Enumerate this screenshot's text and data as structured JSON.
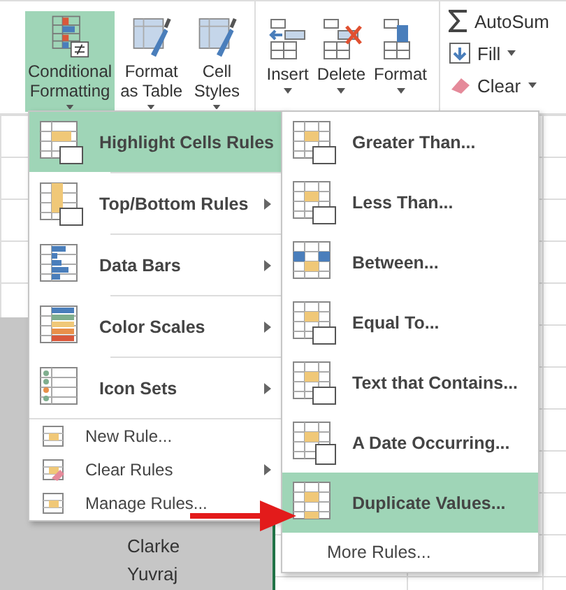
{
  "ribbon": {
    "styles_group": [
      {
        "label": "Conditional Formatting",
        "selected": true
      },
      {
        "label": "Format as Table",
        "selected": false
      },
      {
        "label": "Cell Styles",
        "selected": false
      }
    ],
    "cells_group": [
      {
        "label": "Insert"
      },
      {
        "label": "Delete"
      },
      {
        "label": "Format"
      }
    ],
    "editing_group": [
      {
        "label": "AutoSum"
      },
      {
        "label": "Fill"
      },
      {
        "label": "Clear"
      }
    ]
  },
  "sheet": {
    "names": [
      "Clarke",
      "Yuvraj"
    ]
  },
  "menu": {
    "items": [
      {
        "kind": "submenu",
        "label": "Highlight Cells Rules",
        "selected": true
      },
      {
        "kind": "submenu",
        "label": "Top/Bottom Rules",
        "selected": false
      },
      {
        "kind": "submenu",
        "label": "Data Bars",
        "selected": false
      },
      {
        "kind": "submenu",
        "label": "Color Scales",
        "selected": false
      },
      {
        "kind": "submenu",
        "label": "Icon Sets",
        "selected": false
      },
      {
        "kind": "small",
        "label": "New Rule...",
        "selected": false
      },
      {
        "kind": "small_sub",
        "label": "Clear Rules",
        "selected": false
      },
      {
        "kind": "small",
        "label": "Manage Rules...",
        "selected": false
      }
    ]
  },
  "submenu": {
    "items": [
      {
        "label": "Greater Than...",
        "selected": false
      },
      {
        "label": "Less Than...",
        "selected": false
      },
      {
        "label": "Between...",
        "selected": false
      },
      {
        "label": "Equal To...",
        "selected": false
      },
      {
        "label": "Text that Contains...",
        "selected": false
      },
      {
        "label": "A Date Occurring...",
        "selected": false
      },
      {
        "label": "Duplicate Values...",
        "selected": true
      }
    ],
    "more": "More Rules..."
  }
}
